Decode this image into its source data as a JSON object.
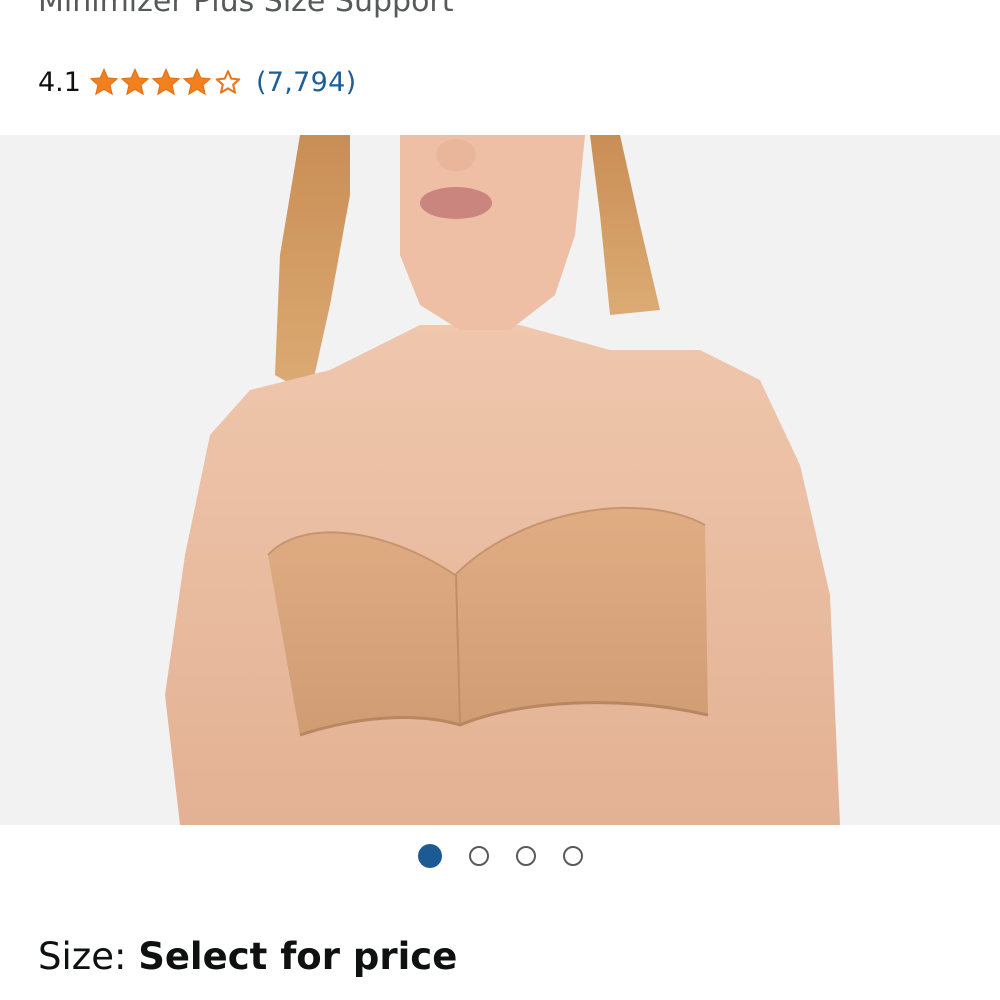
{
  "product": {
    "title_partial": "Minimizer Plus Size Support"
  },
  "rating": {
    "value": "4.1",
    "stars": 4.1,
    "review_count": "(7,794)",
    "star_color": "#f3801e",
    "link_color": "#1f5d97"
  },
  "gallery": {
    "image_label": "product-photo-strapless-bra",
    "dot_count": 4,
    "active_index": 0,
    "active_color": "#1c5a94"
  },
  "size": {
    "label": "Size: ",
    "value": "Select for price"
  }
}
